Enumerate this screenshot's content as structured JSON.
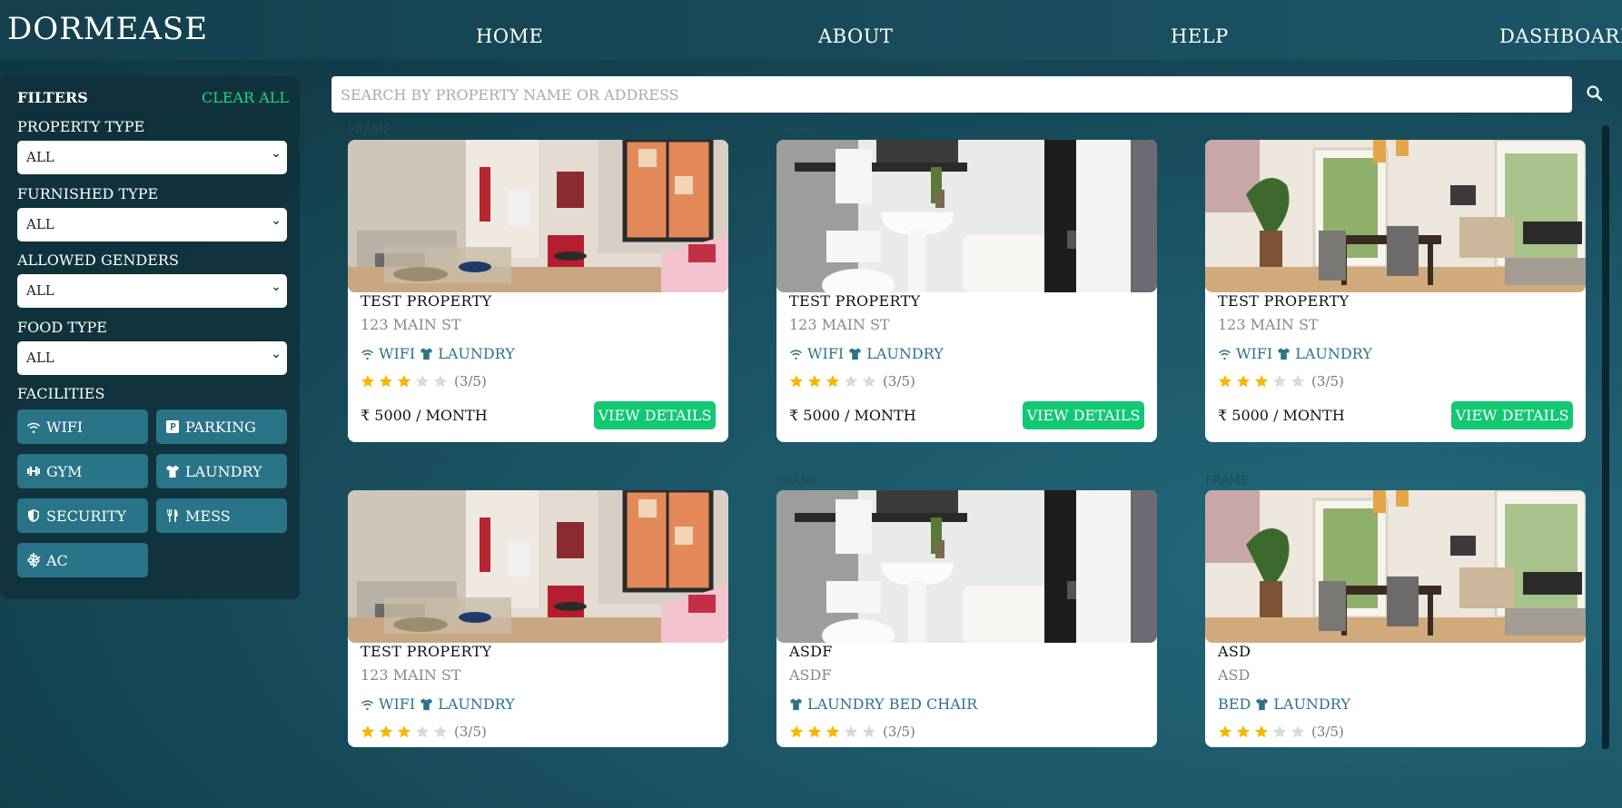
{
  "app": {
    "logo": "DORMEASE"
  },
  "nav": {
    "home": "HOME",
    "about": "ABOUT",
    "help": "HELP",
    "dashboard": "DASHBOARD"
  },
  "filters": {
    "title": "FILTERS",
    "clear": "CLEAR ALL",
    "property_type": {
      "label": "PROPERTY TYPE",
      "value": "ALL"
    },
    "furnished_type": {
      "label": "FURNISHED TYPE",
      "value": "ALL"
    },
    "allowed_genders": {
      "label": "ALLOWED GENDERS",
      "value": "ALL"
    },
    "food_type": {
      "label": "FOOD TYPE",
      "value": "ALL"
    },
    "facilities_label": "FACILITIES",
    "facilities": [
      "WIFI",
      "PARKING",
      "GYM",
      "LAUNDRY",
      "SECURITY",
      "MESS",
      "AC"
    ]
  },
  "search": {
    "placeholder": "SEARCH BY PROPERTY NAME OR ADDRESS"
  },
  "frame_label": "FRAME",
  "cards": [
    {
      "title": "TEST PROPERTY",
      "address": "123 MAIN ST",
      "facilities": [
        "WIFI",
        "LAUNDRY"
      ],
      "rating": 3,
      "rating_text": "(3/5)",
      "price": "₹ 5000 / MONTH",
      "button": "VIEW DETAILS",
      "photo": "living-room"
    },
    {
      "title": "TEST PROPERTY",
      "address": "123 MAIN ST",
      "facilities": [
        "WIFI",
        "LAUNDRY"
      ],
      "rating": 3,
      "rating_text": "(3/5)",
      "price": "₹ 5000 / MONTH",
      "button": "VIEW DETAILS",
      "photo": "bathroom"
    },
    {
      "title": "TEST PROPERTY",
      "address": "123 MAIN ST",
      "facilities": [
        "WIFI",
        "LAUNDRY"
      ],
      "rating": 3,
      "rating_text": "(3/5)",
      "price": "₹ 5000 / MONTH",
      "button": "VIEW DETAILS",
      "photo": "dining-room"
    },
    {
      "title": "TEST PROPERTY",
      "address": "123 MAIN ST",
      "facilities": [
        "WIFI",
        "LAUNDRY"
      ],
      "rating": 3,
      "rating_text": "(3/5)",
      "photo": "living-room"
    },
    {
      "title": "ASDF",
      "address": "ASDF",
      "facilities_text": "LAUNDRY BED CHAIR",
      "rating": 3,
      "rating_text": "(3/5)",
      "photo": "bathroom"
    },
    {
      "title": "ASD",
      "address": "ASD",
      "facilities_prefix": "BED",
      "facilities_text": "LAUNDRY",
      "rating": 3,
      "rating_text": "(3/5)",
      "photo": "dining-room"
    }
  ],
  "colors": {
    "accent_green": "#13c873",
    "teal": "#2a7488",
    "star": "#f5b800"
  }
}
